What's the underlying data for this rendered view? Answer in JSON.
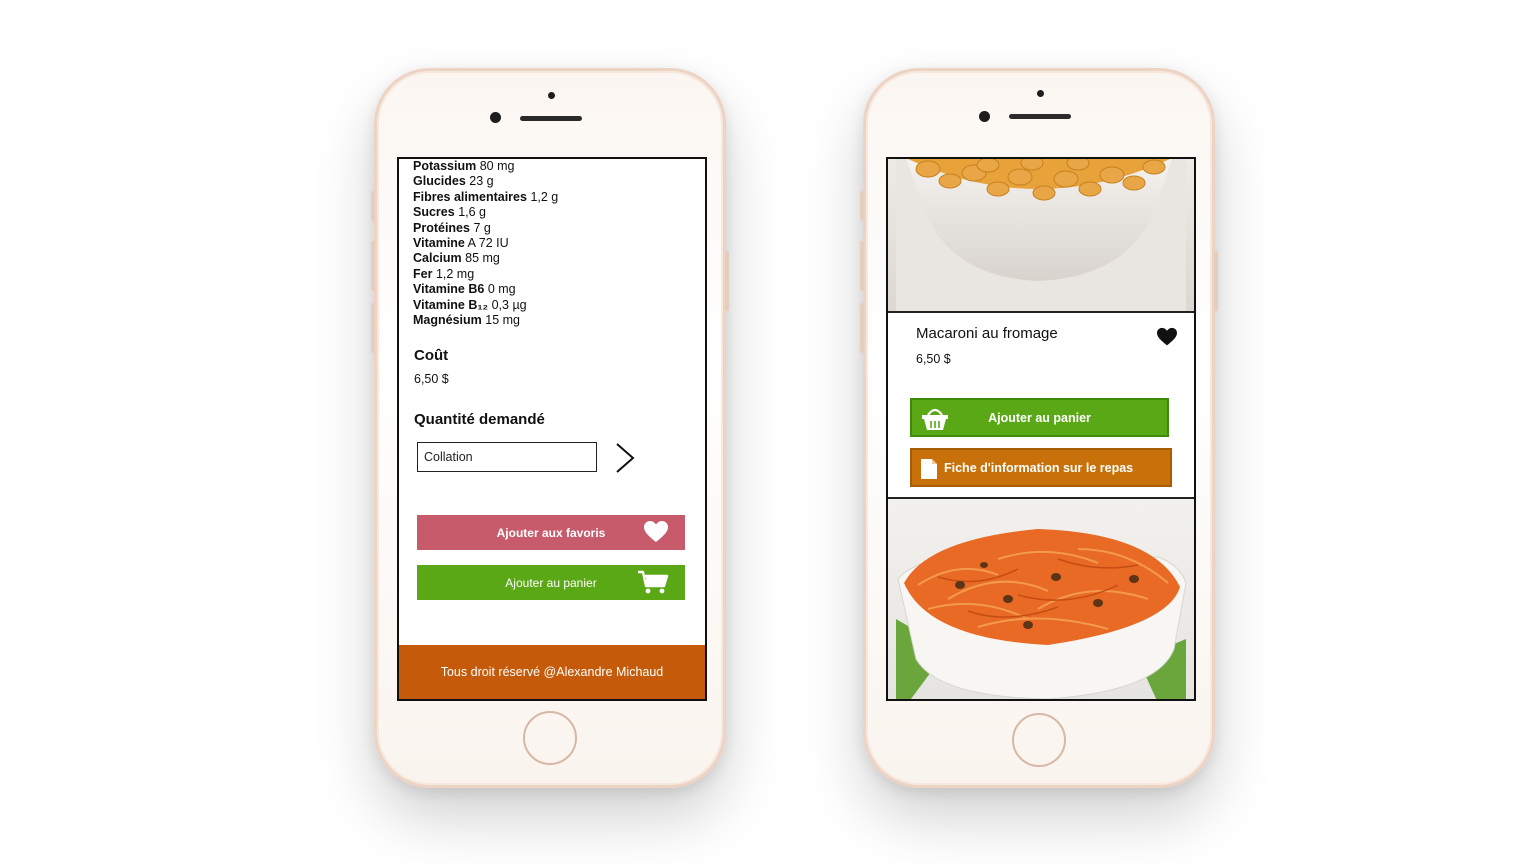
{
  "left_phone": {
    "nutrition": [
      {
        "label": "Potassium",
        "value": "80 mg"
      },
      {
        "label": "Glucides",
        "value": "23 g"
      },
      {
        "label": "Fibres alimentaires",
        "value": "1,2 g"
      },
      {
        "label": "Sucres",
        "value": "1,6 g"
      },
      {
        "label": "Protéines",
        "value": "7 g"
      },
      {
        "label": "Vitamine",
        "value": "A 72 IU"
      },
      {
        "label": "Calcium",
        "value": "85 mg"
      },
      {
        "label": "Fer",
        "value": "1,2 mg"
      },
      {
        "label": "Vitamine B6",
        "value": "0 mg"
      },
      {
        "label": "Vitamine B₁₂",
        "value": "0,3 µg"
      },
      {
        "label": "Magnésium",
        "value": "15 mg"
      }
    ],
    "cost_title": "Coût",
    "cost_value": "6,50 $",
    "quantity_title": "Quantité demandé",
    "quantity_value": "Collation",
    "fav_button": "Ajouter aux favoris",
    "cart_button": "Ajouter au panier",
    "footer": "Tous droit réservé @Alexandre Michaud"
  },
  "right_phone": {
    "meal_name": "Macaroni au fromage",
    "meal_price": "6,50 $",
    "cart_button": "Ajouter au panier",
    "info_button": "Fiche d'information sur le repas"
  },
  "colors": {
    "favorite": "#c75a6b",
    "cart": "#5aa816",
    "info": "#c8710b",
    "footer": "#c45a0a"
  },
  "icons": [
    "heart-icon",
    "cart-icon",
    "basket-icon",
    "document-icon",
    "chevron-right-icon"
  ]
}
